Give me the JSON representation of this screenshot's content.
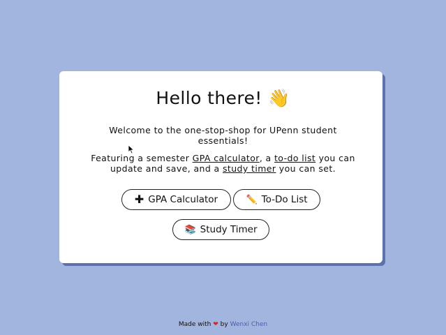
{
  "card": {
    "title": "Hello there!",
    "title_emoji": "👋",
    "intro": "Welcome to the one-stop-shop for UPenn student essentials!",
    "featuring_prefix": "Featuring a semester ",
    "gpa_link": "GPA calculator",
    "sep1": ", a ",
    "todo_link": "to-do list",
    "sep2": " you can update and save, and a ",
    "timer_link": "study timer",
    "suffix": " you can set."
  },
  "buttons": {
    "gpa": {
      "icon": "plus-icon",
      "glyph": "✚",
      "label": "GPA Calculator"
    },
    "todo": {
      "icon": "pencil-icon",
      "glyph": "✏️",
      "label": "To-Do List"
    },
    "timer": {
      "icon": "books-icon",
      "glyph": "📚",
      "label": "Study Timer"
    }
  },
  "footer": {
    "made_with": "Made with",
    "heart": "❤",
    "by": "by",
    "author": "Wenxi Chen"
  },
  "colors": {
    "background": "#a2b5de",
    "card_shadow": "#5b72ad",
    "link_author": "#4a5fa8",
    "heart": "#d8232a"
  }
}
